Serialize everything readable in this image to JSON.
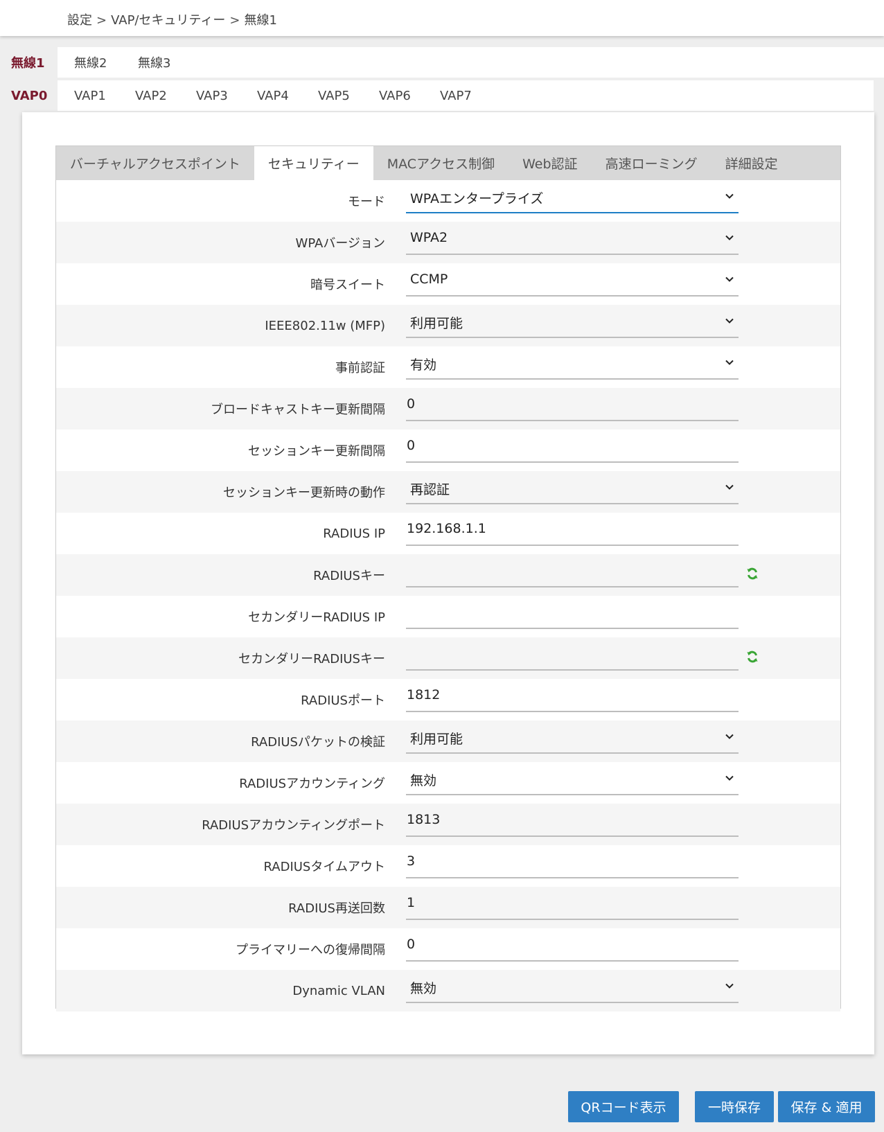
{
  "breadcrumb": [
    "設定",
    "VAP/セキュリティー",
    "無線1"
  ],
  "radio_tabs": {
    "active": "無線1",
    "items": [
      "無線2",
      "無線3"
    ]
  },
  "vap_tabs": {
    "active": "VAP0",
    "items": [
      "VAP1",
      "VAP2",
      "VAP3",
      "VAP4",
      "VAP5",
      "VAP6",
      "VAP7"
    ]
  },
  "sub_tabs": [
    {
      "label": "バーチャルアクセスポイント",
      "active": false
    },
    {
      "label": "セキュリティー",
      "active": true
    },
    {
      "label": "MACアクセス制御",
      "active": false
    },
    {
      "label": "Web認証",
      "active": false
    },
    {
      "label": "高速ローミング",
      "active": false
    },
    {
      "label": "詳細設定",
      "active": false
    }
  ],
  "form": [
    {
      "label": "モード",
      "type": "select",
      "value": "WPAエンタープライズ",
      "focused": true
    },
    {
      "label": "WPAバージョン",
      "type": "select",
      "value": "WPA2"
    },
    {
      "label": "暗号スイート",
      "type": "select",
      "value": "CCMP"
    },
    {
      "label": "IEEE802.11w (MFP)",
      "type": "select",
      "value": "利用可能"
    },
    {
      "label": "事前認証",
      "type": "select",
      "value": "有効"
    },
    {
      "label": "ブロードキャストキー更新間隔",
      "type": "input",
      "value": "0"
    },
    {
      "label": "セッションキー更新間隔",
      "type": "input",
      "value": "0"
    },
    {
      "label": "セッションキー更新時の動作",
      "type": "select",
      "value": "再認証"
    },
    {
      "label": "RADIUS IP",
      "type": "input",
      "value": "192.168.1.1"
    },
    {
      "label": "RADIUSキー",
      "type": "input",
      "value": "",
      "refresh": true
    },
    {
      "label": "セカンダリーRADIUS IP",
      "type": "input",
      "value": ""
    },
    {
      "label": "セカンダリーRADIUSキー",
      "type": "input",
      "value": "",
      "refresh": true
    },
    {
      "label": "RADIUSポート",
      "type": "input",
      "value": "1812"
    },
    {
      "label": "RADIUSパケットの検証",
      "type": "select",
      "value": "利用可能"
    },
    {
      "label": "RADIUSアカウンティング",
      "type": "select",
      "value": "無効"
    },
    {
      "label": "RADIUSアカウンティングポート",
      "type": "input",
      "value": "1813"
    },
    {
      "label": "RADIUSタイムアウト",
      "type": "input",
      "value": "3"
    },
    {
      "label": "RADIUS再送回数",
      "type": "input",
      "value": "1"
    },
    {
      "label": "プライマリーへの復帰間隔",
      "type": "input",
      "value": "0"
    },
    {
      "label": "Dynamic VLAN",
      "type": "select",
      "value": "無効"
    }
  ],
  "buttons": {
    "qr": "QRコード表示",
    "temp_save": "一時保存",
    "save_apply": "保存 & 適用"
  },
  "colors": {
    "accent_blue": "#2f7fc4",
    "active_tab_text": "#7a1a2e",
    "focus_underline": "#1e7fc6",
    "refresh_green": "#3aa535"
  }
}
